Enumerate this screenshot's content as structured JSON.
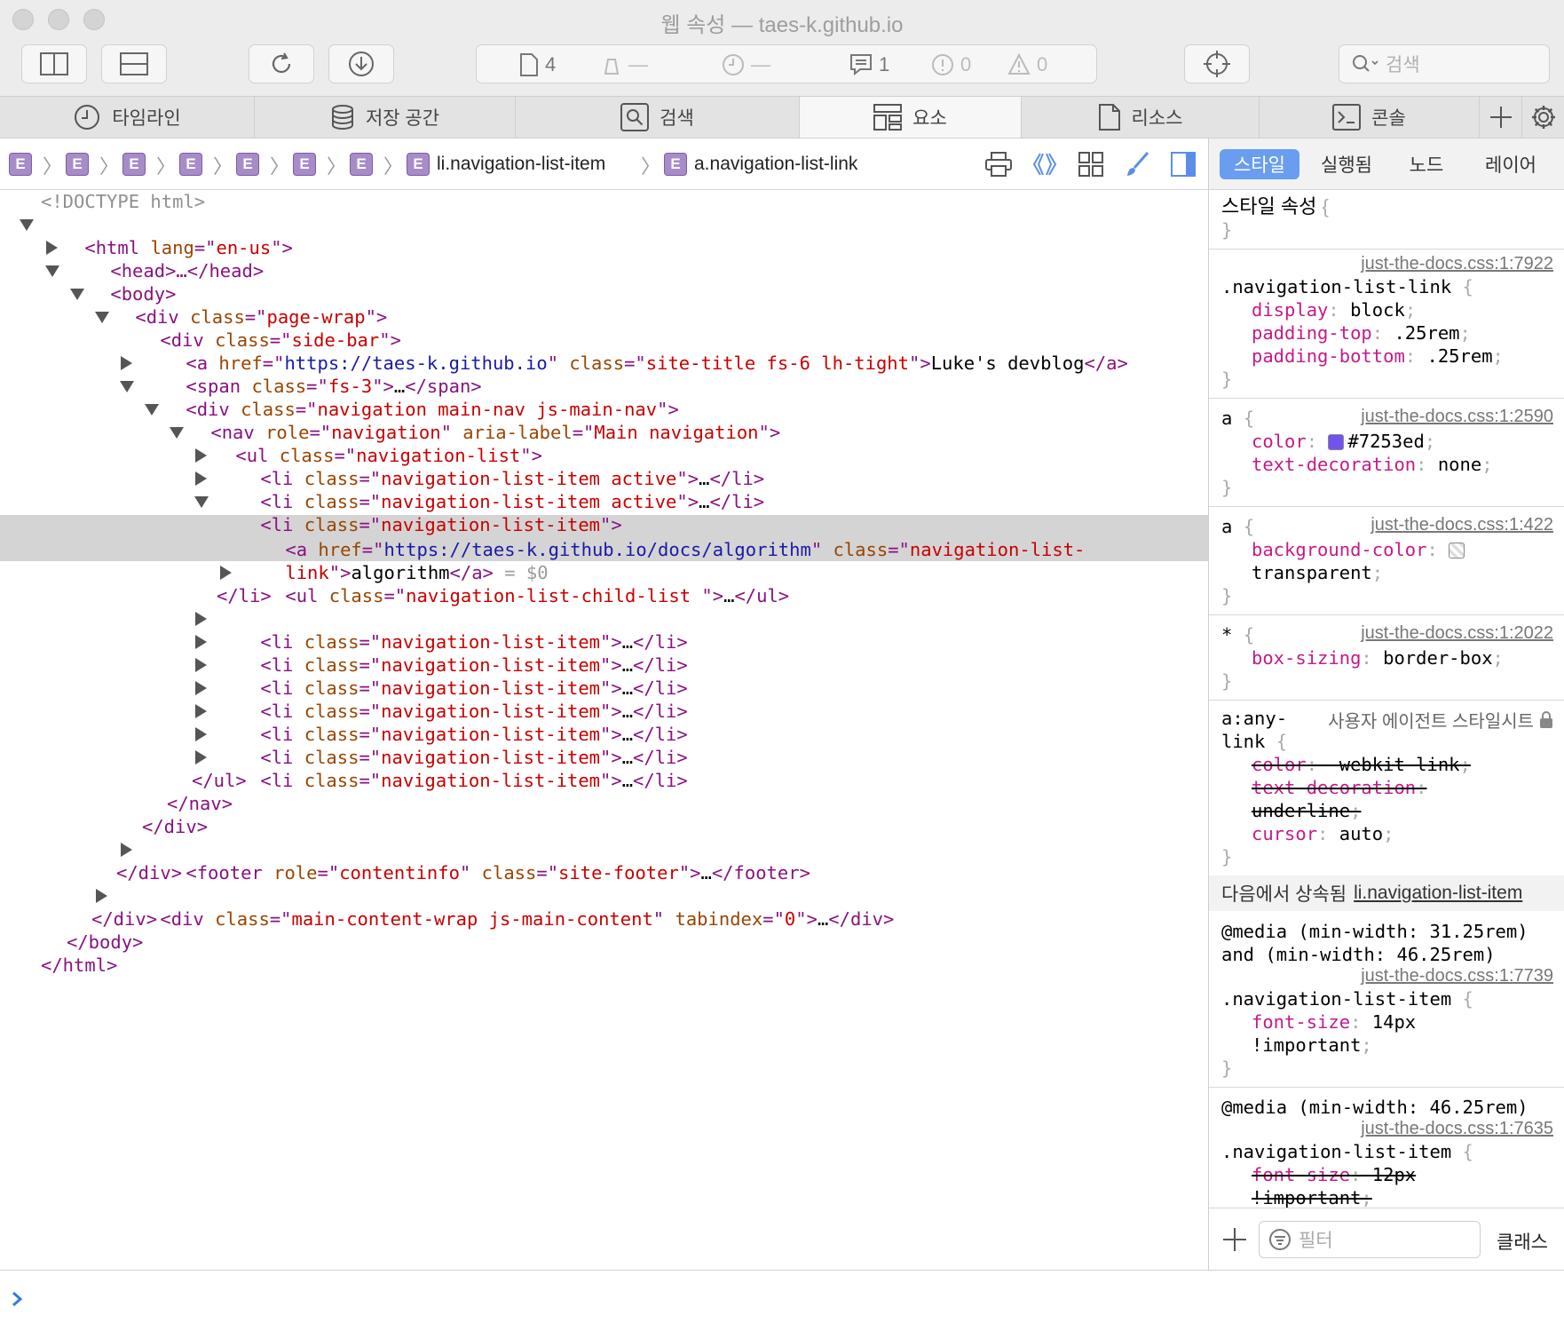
{
  "window": {
    "title": "웹 속성 — taes-k.github.io"
  },
  "toolbar": {
    "stats": [
      {
        "name": "resources-count",
        "value": "4"
      },
      {
        "name": "bytes",
        "value": "—"
      },
      {
        "name": "time",
        "value": "—"
      },
      {
        "name": "logs-count",
        "value": "1"
      },
      {
        "name": "errors-count",
        "value": "0"
      },
      {
        "name": "warnings-count",
        "value": "0"
      }
    ],
    "search_placeholder": "검색"
  },
  "tabs": [
    {
      "label": "타임라인",
      "icon": "clock-icon"
    },
    {
      "label": "저장 공간",
      "icon": "database-icon"
    },
    {
      "label": "검색",
      "icon": "search-icon"
    },
    {
      "label": "요소",
      "icon": "elements-icon",
      "selected": true
    },
    {
      "label": "리소스",
      "icon": "document-icon"
    },
    {
      "label": "콘솔",
      "icon": "console-icon"
    }
  ],
  "breadcrumb": {
    "element_badge": "E",
    "items": [
      "li.navigation-list-item",
      "a.navigation-list-link"
    ]
  },
  "dom": {
    "doctype": "<!DOCTYPE html>",
    "html_open": {
      "tag": "html",
      "attr": "lang",
      "value": "en-us"
    },
    "head": "<head>…</head>",
    "body_open": "<body>",
    "page_wrap_class": "page-wrap",
    "side_bar_class": "side-bar",
    "site_title_href": "https://taes-k.github.io",
    "site_title_class": "site-title fs-6 lh-tight",
    "site_title_text": "Luke's devblog",
    "span_class": "fs-3",
    "nav_div_class": "navigation main-nav js-main-nav",
    "nav_role": "navigation",
    "nav_aria_label": "Main navigation",
    "ul_class": "navigation-list",
    "li_active_class": "navigation-list-item active",
    "li_class": "navigation-list-item",
    "selected_href": "https://taes-k.github.io/docs/algorithm",
    "selected_class_part1": "navigation-list-",
    "selected_class_part2": "link",
    "selected_text": "algorithm",
    "selected_ref": "= $0",
    "child_list_class": "navigation-list-child-list ",
    "footer_role": "contentinfo",
    "footer_class": "site-footer",
    "main_content_class": "main-content-wrap js-main-content",
    "main_content_tabindex": "0",
    "ellipsis": "…"
  },
  "sidebar": {
    "tabs": [
      "스타일",
      "실행됨",
      "노드",
      "레이어"
    ],
    "style_attr_label": "스타일 속성",
    "rules": [
      {
        "source": "just-the-docs.css:1:7922",
        "selector": ".navigation-list-link",
        "props": [
          [
            "display",
            "block"
          ],
          [
            "padding-top",
            ".25rem"
          ],
          [
            "padding-bottom",
            ".25rem"
          ]
        ]
      },
      {
        "source": "just-the-docs.css:1:2590",
        "selector": "a",
        "props": [
          [
            "color",
            "#7253ed"
          ],
          [
            "text-decoration",
            "none"
          ]
        ]
      },
      {
        "source": "just-the-docs.css:1:422",
        "selector": "a",
        "props": [
          [
            "background-color",
            "transparent"
          ]
        ]
      },
      {
        "source": "just-the-docs.css:1:2022",
        "selector": "*",
        "props": [
          [
            "box-sizing",
            "border-box"
          ]
        ]
      }
    ],
    "ua_rule": {
      "selector_line1": "a:any-",
      "selector_line2": "link",
      "label": "사용자 에이전트 스타일시트",
      "props": [
        [
          "color",
          "-webkit-link"
        ],
        [
          "text-decoration",
          "underline"
        ],
        [
          "cursor",
          "auto"
        ]
      ]
    },
    "inherited": {
      "label": "다음에서 상속됨",
      "link": "li.navigation-list-item"
    },
    "media1": {
      "line1": "@media (min-width: 31.25rem)",
      "line2": "and (min-width: 46.25rem)",
      "source": "just-the-docs.css:1:7739",
      "selector": ".navigation-list-item",
      "prop": "font-size",
      "value": "14px",
      "important": "!important"
    },
    "media2": {
      "line1": "@media (min-width: 46.25rem)",
      "source": "just-the-docs.css:1:7635",
      "selector": ".navigation-list-item",
      "prop": "font-size",
      "value": "12px",
      "important": "!important"
    },
    "filter_placeholder": "필터",
    "class_button": "클래스"
  },
  "colors": {
    "link_color": "#7253ed",
    "accent": "#6a9df0",
    "tag": "#881280",
    "attr_name": "#994500",
    "attr_value": "#1a1aa6"
  }
}
